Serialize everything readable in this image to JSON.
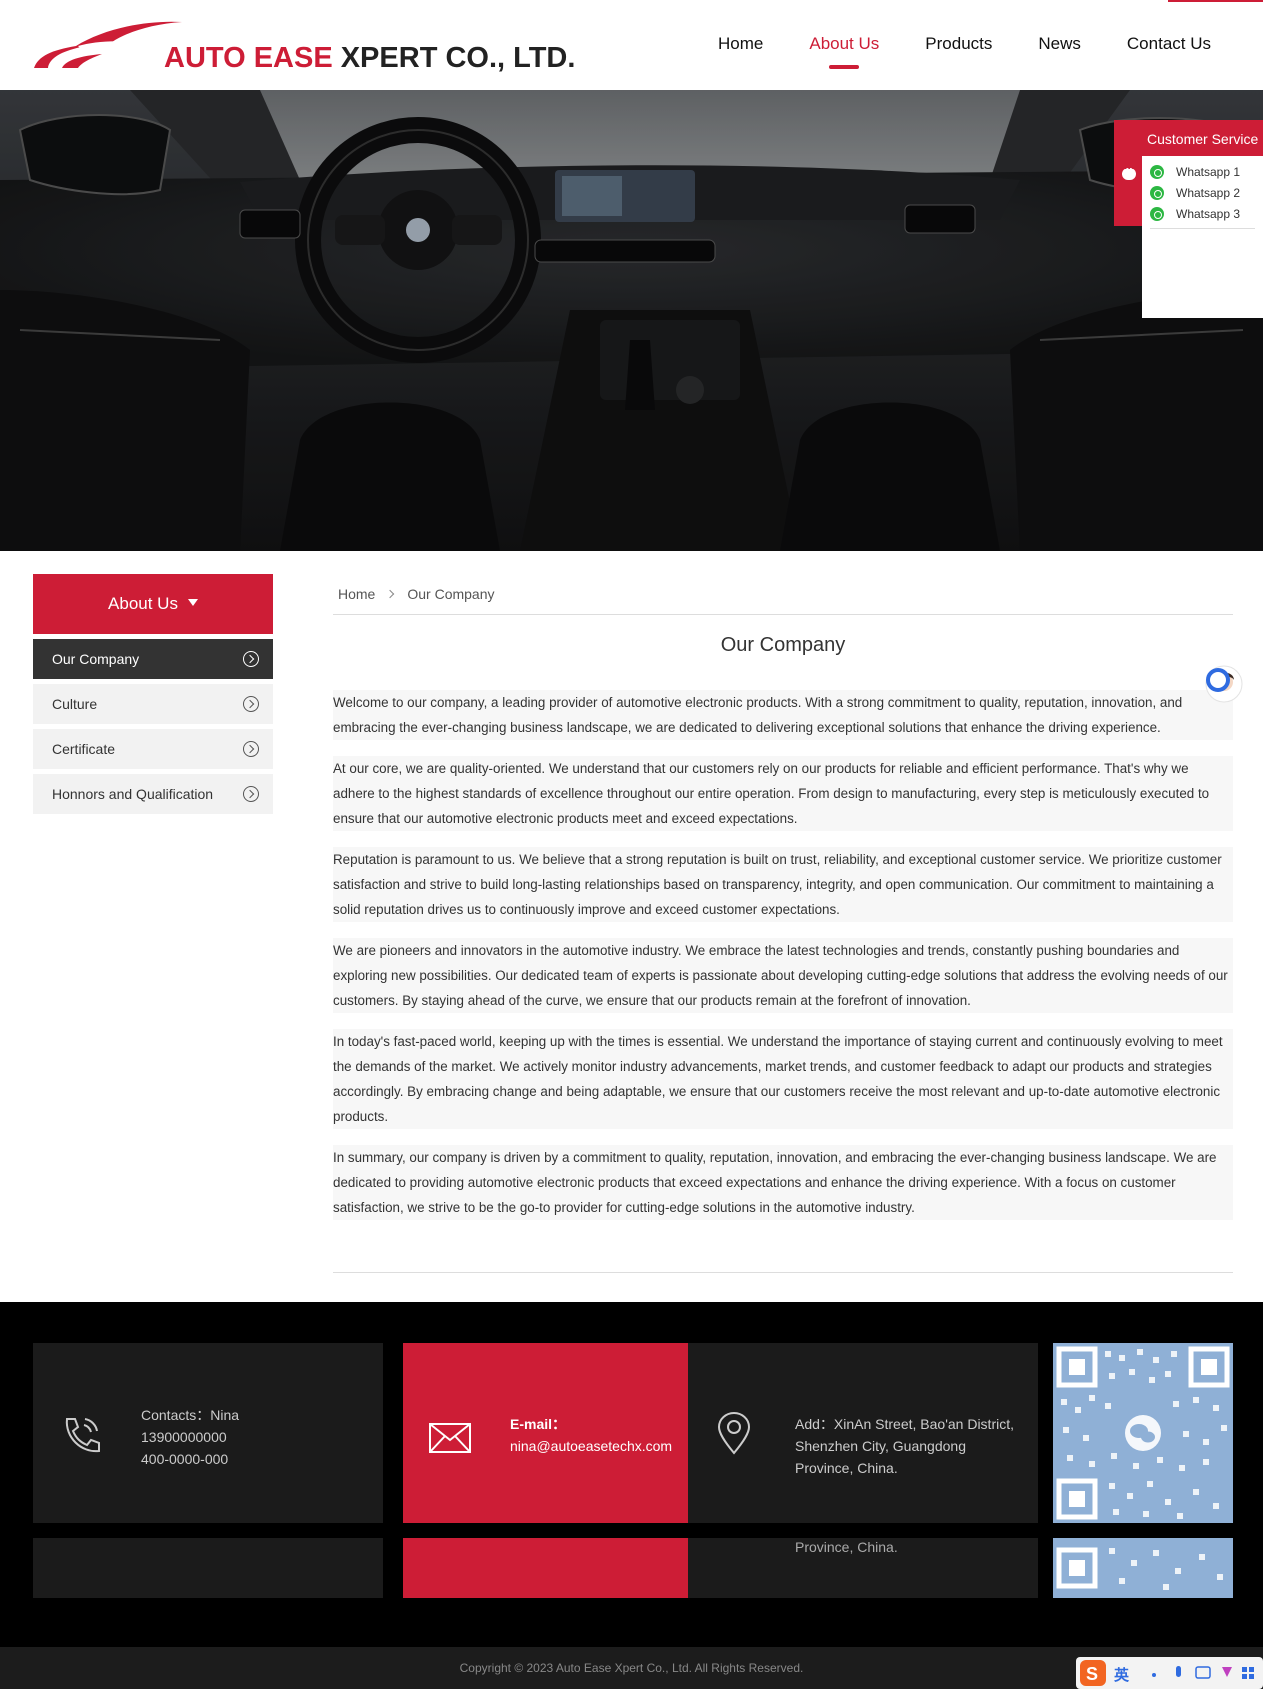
{
  "header": {
    "logo_text_red": "AUTO EASE ",
    "logo_text_dark": "XPERT CO., LTD.",
    "nav": [
      {
        "label": "Home"
      },
      {
        "label": "About Us"
      },
      {
        "label": "Products"
      },
      {
        "label": "News"
      },
      {
        "label": "Contact Us"
      }
    ]
  },
  "customer_service": {
    "title": "Customer Service",
    "items": [
      {
        "label": "Whatsapp 1"
      },
      {
        "label": "Whatsapp 2"
      },
      {
        "label": "Whatsapp 3"
      }
    ]
  },
  "sidebar": {
    "title": "About Us",
    "items": [
      {
        "label": "Our Company"
      },
      {
        "label": "Culture"
      },
      {
        "label": "Certificate"
      },
      {
        "label": "Honnors and Qualification"
      }
    ]
  },
  "breadcrumb": {
    "home": "Home",
    "current": "Our Company"
  },
  "main": {
    "title": "Our Company",
    "paragraphs": [
      "Welcome to our company, a leading provider of automotive electronic products. With a strong commitment to quality, reputation, innovation, and embracing the ever-changing business landscape, we are dedicated to delivering exceptional solutions that enhance the driving experience.",
      "At our core, we are quality-oriented. We understand that our customers rely on our products for reliable and efficient performance. That's why we adhere to the highest standards of excellence throughout our entire operation. From design to manufacturing, every step is meticulously executed to ensure that our automotive electronic products meet and exceed expectations.",
      "Reputation is paramount to us. We believe that a strong reputation is built on trust, reliability, and exceptional customer service. We prioritize customer satisfaction and strive to build long-lasting relationships based on transparency, integrity, and open communication. Our commitment to maintaining a solid reputation drives us to continuously improve and exceed customer expectations.",
      "We are pioneers and innovators in the automotive industry. We embrace the latest technologies and trends, constantly pushing boundaries and exploring new possibilities. Our dedicated team of experts is passionate about developing cutting-edge solutions that address the evolving needs of our customers. By staying ahead of the curve, we ensure that our products remain at the forefront of innovation.",
      "In today's fast-paced world, keeping up with the times is essential. We understand the importance of staying current and continuously evolving to meet the demands of the market. We actively monitor industry advancements, market trends, and customer feedback to adapt our products and strategies accordingly. By embracing change and being adaptable, we ensure that our customers receive the most relevant and up-to-date automotive electronic products.",
      "In summary, our company is driven by a commitment to quality, reputation, innovation, and embracing the ever-changing business landscape. We are dedicated to providing automotive electronic products that exceed expectations and enhance the driving experience. With a focus on customer satisfaction, we strive to be the go-to provider for cutting-edge solutions in the automotive industry."
    ]
  },
  "footer": {
    "contacts": {
      "line1": "Contacts：Nina",
      "line2": "13900000000",
      "line3": "400-0000-000"
    },
    "email": {
      "label": "E-mail：",
      "value": "nina@autoeasetechx.com"
    },
    "address": {
      "text": "Add：XinAn Street, Bao'an District, Shenzhen City, Guangdong Province, China.",
      "overflow": "Province, China."
    },
    "copyright": "Copyright © 2023 Auto Ease Xpert Co., Ltd. All Rights Reserved."
  },
  "ime_bar": {
    "label": "英"
  },
  "colors": {
    "accent": "#cd1d36",
    "footer_bg": "#000000",
    "footer_box": "#1b1b1b"
  }
}
